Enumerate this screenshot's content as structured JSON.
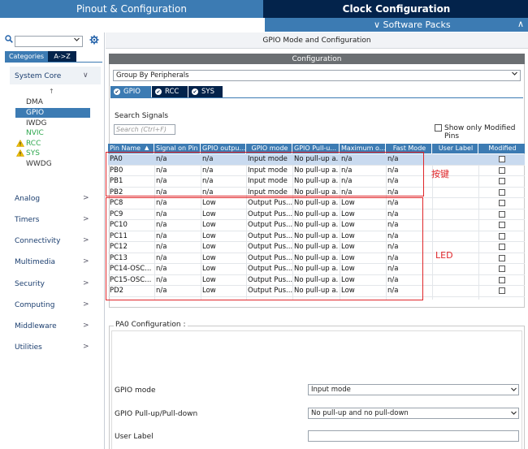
{
  "header": {
    "tab_pinout": "Pinout & Configuration",
    "tab_clock": "Clock Configuration",
    "software_packs": "∨ Software Packs",
    "software_packs_chevron": "∧"
  },
  "sidebar": {
    "tab_categories": "Categories",
    "tab_az": "A->Z",
    "categories": [
      {
        "label": "System Core",
        "chevron": "∨"
      },
      {
        "label": "Analog",
        "chevron": ">"
      },
      {
        "label": "Timers",
        "chevron": ">"
      },
      {
        "label": "Connectivity",
        "chevron": ">"
      },
      {
        "label": "Multimedia",
        "chevron": ">"
      },
      {
        "label": "Security",
        "chevron": ">"
      },
      {
        "label": "Computing",
        "chevron": ">"
      },
      {
        "label": "Middleware",
        "chevron": ">"
      },
      {
        "label": "Utilities",
        "chevron": ">"
      }
    ],
    "system_core_items": [
      "DMA",
      "GPIO",
      "IWDG",
      "NVIC",
      "RCC",
      "SYS",
      "WWDG"
    ],
    "sort_arrow": "↑"
  },
  "main": {
    "title": "GPIO Mode and Configuration",
    "configuration_label": "Configuration",
    "group_by": "Group By Peripherals",
    "peripheral_tabs": [
      "GPIO",
      "RCC",
      "SYS"
    ],
    "search_signals_label": "Search Signals",
    "search_placeholder": "Search (Ctrl+F)",
    "show_modified_label": "Show only Modified Pins",
    "columns": [
      "Pin Name",
      "Signal on Pin",
      "GPIO outpu...",
      "GPIO mode",
      "GPIO Pull-u...",
      "Maximum o...",
      "Fast Mode",
      "User Label",
      "Modified"
    ],
    "rows": [
      [
        "PA0",
        "n/a",
        "n/a",
        "Input mode",
        "No pull-up a...",
        "n/a",
        "n/a",
        "",
        ""
      ],
      [
        "PB0",
        "n/a",
        "n/a",
        "Input mode",
        "No pull-up a...",
        "n/a",
        "n/a",
        "",
        ""
      ],
      [
        "PB1",
        "n/a",
        "n/a",
        "Input mode",
        "No pull-up a...",
        "n/a",
        "n/a",
        "",
        ""
      ],
      [
        "PB2",
        "n/a",
        "n/a",
        "Input mode",
        "No pull-up a...",
        "n/a",
        "n/a",
        "",
        ""
      ],
      [
        "PC8",
        "n/a",
        "Low",
        "Output Pus...",
        "No pull-up a...",
        "Low",
        "n/a",
        "",
        ""
      ],
      [
        "PC9",
        "n/a",
        "Low",
        "Output Pus...",
        "No pull-up a...",
        "Low",
        "n/a",
        "",
        ""
      ],
      [
        "PC10",
        "n/a",
        "Low",
        "Output Pus...",
        "No pull-up a...",
        "Low",
        "n/a",
        "",
        ""
      ],
      [
        "PC11",
        "n/a",
        "Low",
        "Output Pus...",
        "No pull-up a...",
        "Low",
        "n/a",
        "",
        ""
      ],
      [
        "PC12",
        "n/a",
        "Low",
        "Output Pus...",
        "No pull-up a...",
        "Low",
        "n/a",
        "",
        ""
      ],
      [
        "PC13",
        "n/a",
        "Low",
        "Output Pus...",
        "No pull-up a...",
        "Low",
        "n/a",
        "",
        ""
      ],
      [
        "PC14-OSC...",
        "n/a",
        "Low",
        "Output Pus...",
        "No pull-up a...",
        "Low",
        "n/a",
        "",
        ""
      ],
      [
        "PC15-OSC...",
        "n/a",
        "Low",
        "Output Pus...",
        "No pull-up a...",
        "Low",
        "n/a",
        "",
        ""
      ],
      [
        "PD2",
        "n/a",
        "Low",
        "Output Pus...",
        "No pull-up a...",
        "Low",
        "n/a",
        "",
        ""
      ]
    ],
    "annotation_keys": "按键",
    "annotation_led": "LED",
    "pa0_config_title": "PA0 Configuration :",
    "fields": [
      {
        "label": "GPIO mode",
        "value": "Input mode"
      },
      {
        "label": "GPIO Pull-up/Pull-down",
        "value": "No pull-up and no pull-down"
      },
      {
        "label": "User Label",
        "value": ""
      }
    ]
  },
  "icons": {
    "search": "search-icon",
    "gear": "gear-icon",
    "warning": "warning-icon",
    "chevron": "chevron-down-icon"
  },
  "colors": {
    "navy": "#03234b",
    "accent": "#3c7bb3",
    "selected_row": "#c9daef",
    "annotation": "#e0262a",
    "nvic": "#2fa84f",
    "warning": "#f2c200"
  }
}
